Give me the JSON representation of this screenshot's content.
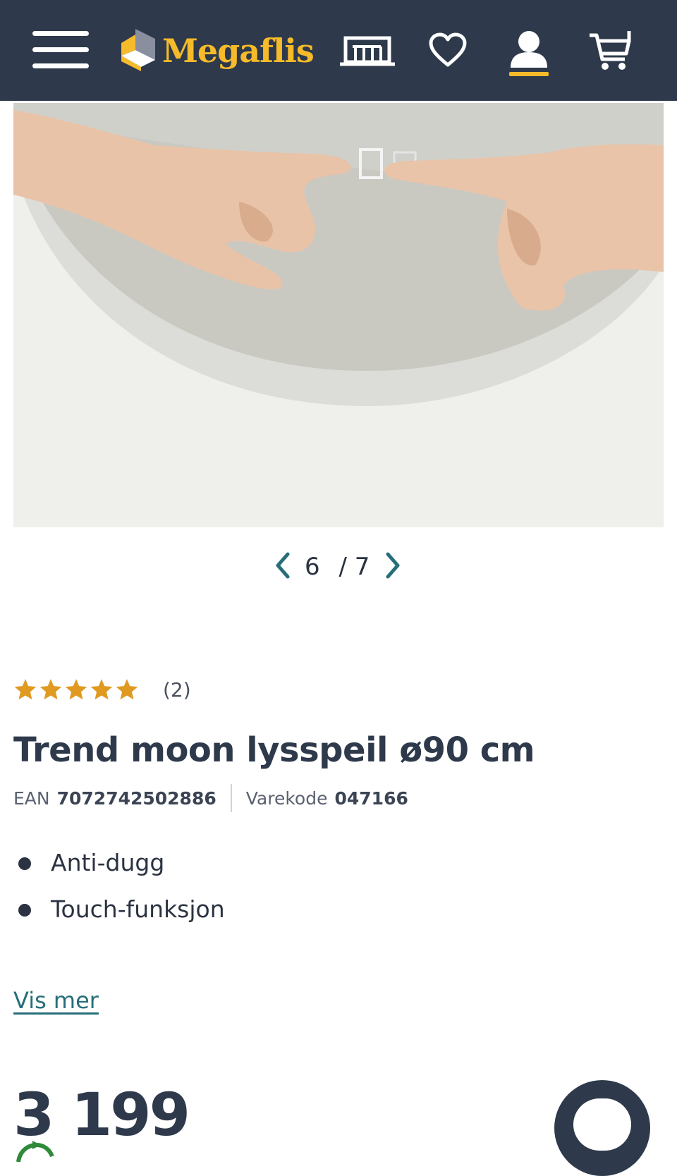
{
  "header": {
    "logo_text": "Megaflis",
    "icons": [
      "menu-icon",
      "megaflis-logo-icon",
      "store-icon",
      "heart-icon",
      "user-icon",
      "cart-icon"
    ],
    "background_color": "#2e3a4b",
    "accent_color": "#f6bb2a"
  },
  "gallery": {
    "current": "6",
    "total": "/ 7",
    "image_description_icon": "mirror-touch-photo"
  },
  "product": {
    "rating_stars": 5,
    "review_count": "(2)",
    "title": "Trend moon lysspeil ø90 cm",
    "ean_label": "EAN",
    "ean_value": "7072742502886",
    "code_label": "Varekode",
    "code_value": "047166",
    "features": [
      "Anti-dugg",
      "Touch-funksjon"
    ],
    "show_more": "Vis mer",
    "price": "3 199"
  },
  "colors": {
    "star": "#e09a22",
    "link": "#276e7a",
    "title": "#2e3a4b"
  }
}
